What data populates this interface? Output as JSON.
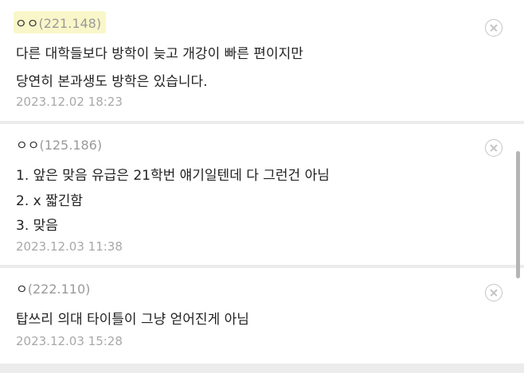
{
  "comments": [
    {
      "author": "ㅇㅇ",
      "ip": "(221.148)",
      "lines": [
        "다른 대학들보다 방학이 늦고 개강이 빠른 편이지만",
        "당연히 본과생도 방학은 있습니다."
      ],
      "date": "2023.12.02 18:23"
    },
    {
      "author": "ㅇㅇ",
      "ip": "(125.186)",
      "lines": [
        "1. 앞은 맞음 유급은 21학번 얘기일텐데 다 그런건 아님",
        "2. x 짧긴함",
        "3. 맞음"
      ],
      "date": "2023.12.03 11:38"
    },
    {
      "author": "ㅇ",
      "ip": "(222.110)",
      "lines": [
        "탑쓰리 의대 타이틀이 그냥 얻어진게 아님"
      ],
      "date": "2023.12.03 15:28"
    }
  ],
  "icons": {
    "delete": "close-circle-icon"
  }
}
